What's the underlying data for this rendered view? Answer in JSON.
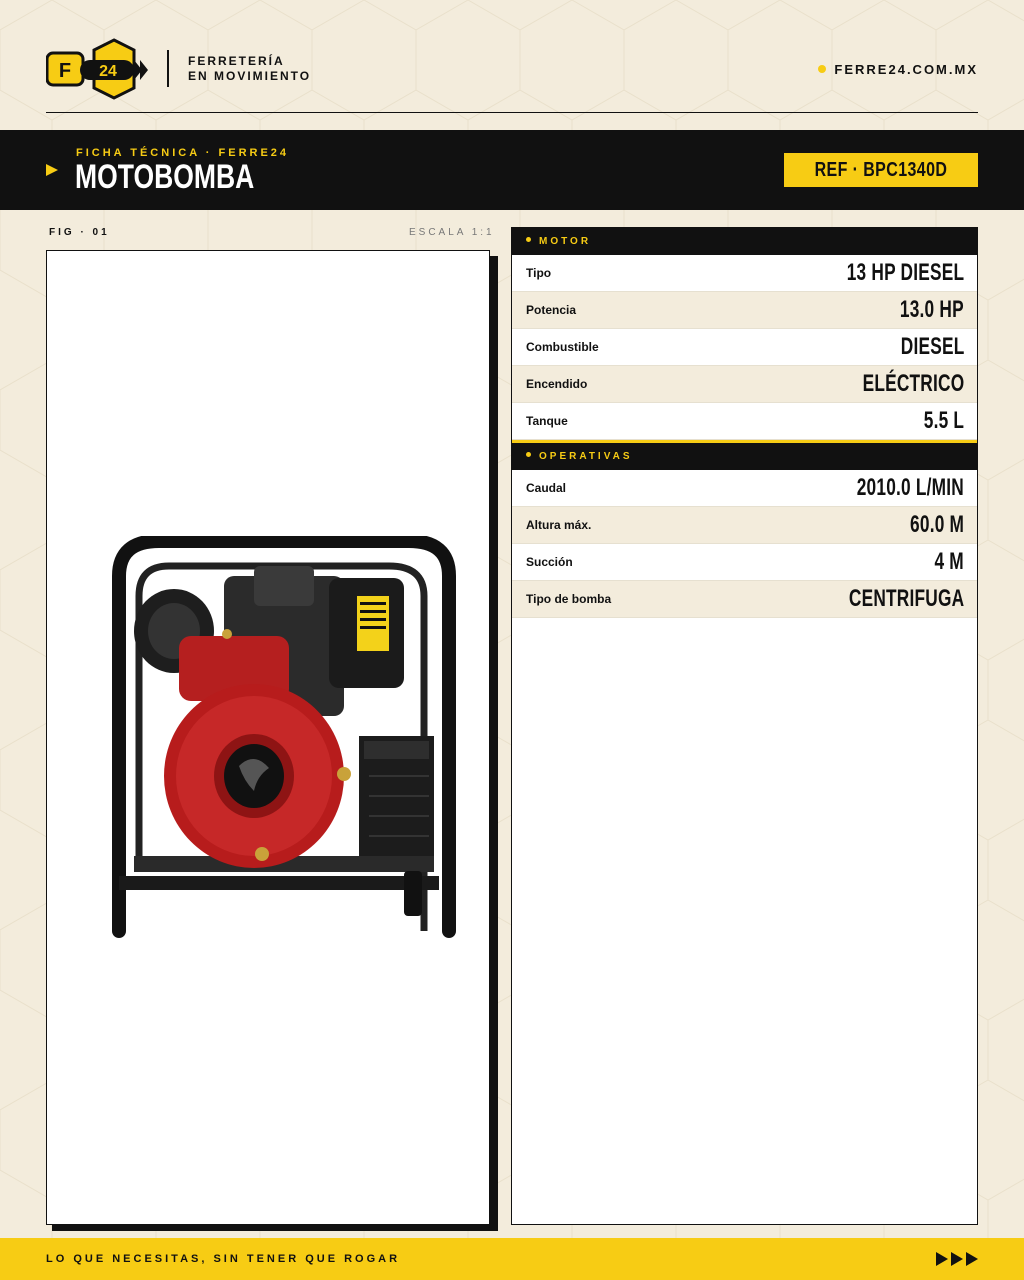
{
  "brand": {
    "logo_text": "F 24",
    "tagline_line1": "FERRETERÍA",
    "tagline_line2": "EN MOVIMIENTO",
    "website": "FERRE24.COM.MX",
    "accent_color": "#f7cc14",
    "dark_color": "#111111"
  },
  "title_band": {
    "eyebrow": "FICHA TÉCNICA · FERRE24",
    "title": "MOTOBOMBA",
    "ref": "REF · BPC1340D"
  },
  "figure": {
    "label": "FIG · 01",
    "scale": "ESCALA 1:1"
  },
  "specs": {
    "motor": {
      "heading": "MOTOR",
      "rows": [
        {
          "key": "Tipo",
          "value": "13 HP DIESEL"
        },
        {
          "key": "Potencia",
          "value": "13.0 HP"
        },
        {
          "key": "Combustible",
          "value": "DIESEL"
        },
        {
          "key": "Encendido",
          "value": "ELÉCTRICO"
        },
        {
          "key": "Tanque",
          "value": "5.5 L"
        }
      ]
    },
    "operativas": {
      "heading": "OPERATIVAS",
      "rows": [
        {
          "key": "Caudal",
          "value": "2010.0 L/MIN"
        },
        {
          "key": "Altura máx.",
          "value": "60.0 M"
        },
        {
          "key": "Succión",
          "value": "4 M"
        },
        {
          "key": "Tipo de bomba",
          "value": "CENTRIFUGA"
        }
      ]
    }
  },
  "footer": {
    "slogan": "LO QUE NECESITAS, SIN TENER QUE ROGAR"
  }
}
